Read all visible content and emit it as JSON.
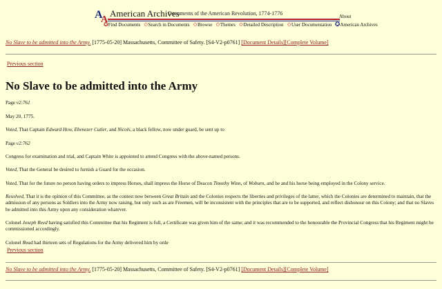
{
  "header": {
    "brand": "American Archives",
    "subtitle": "Documents of the American Revolution, 1774-1776",
    "about": "About",
    "nav": [
      "Find Documents",
      "Search in Documents",
      "Browse",
      "Themes",
      "Detailed Description",
      "User Documentation",
      "American Archives"
    ]
  },
  "crumb": {
    "title_link": "No Slave to be admitted into the Army.",
    "meta": "[1775-05-20] Massachusetts, Committee of Safety. [S4-V2-p0761]",
    "doc_details": "[Document Details]",
    "complete_volume": "[Complete Volume]"
  },
  "prev_section": "Previous section",
  "title": "No Slave to be admitted into the Army",
  "page1": {
    "label": "Page",
    "ref": "v2:761"
  },
  "date": "May 20, 1775.",
  "voted1": {
    "a": "Voted",
    "b": ", That Captain ",
    "c": "Edward How, Ebenezer Cutler",
    "d": ", and ",
    "e": "Nicols",
    "f": ", a black fellow, now under guard, be sent up to"
  },
  "page2": {
    "label": "Page",
    "ref": "v2:762"
  },
  "congress": {
    "a": "Congress for examination and trial, and Captain ",
    "b": "White",
    "c": " is appointed to attend Congress with the above-named persons."
  },
  "voted2": {
    "a": "Voted",
    "b": ", That the General be desired to furnish a Guard for the occasion."
  },
  "voted3": {
    "a": "Voted",
    "b": ", That for the future no person having orders to impress Horses, shall impress the Horse of Deacon ",
    "c": "Timothy Winn",
    "d": ", of ",
    "e": "Woburn",
    "f": ", and he and his horse being employed in the Colony service."
  },
  "resolved": {
    "a": "Resolved",
    "b": ", That it is the opinion of this Committee, as the contest now between ",
    "c": "Great Britain",
    "d": " and the Colonies respects the liberties and privileges of the latter, which the Colonies are determined to maintain, that the admission of any persons as Soldiers into the Army now raising, but only such as are Freemen, will be inconsistent with the principles that are to be supported, and reflect dishonour on this Colony; and that no Slaves be admitted into this Army upon any consideration whatever."
  },
  "reed": {
    "a": "Colonel ",
    "b": "Joseph Reed",
    "c": " having satisfied this Committee that his Regiment is full, a Certificate was given him of the same; and it was recommended to the honourable the Provincial Congress that his Regiment might be commissioned accordingly."
  },
  "read": {
    "a": "Colonel ",
    "b": "Read",
    "c": " had thirteen sets of Regulations for the Army delivered him by orde"
  }
}
